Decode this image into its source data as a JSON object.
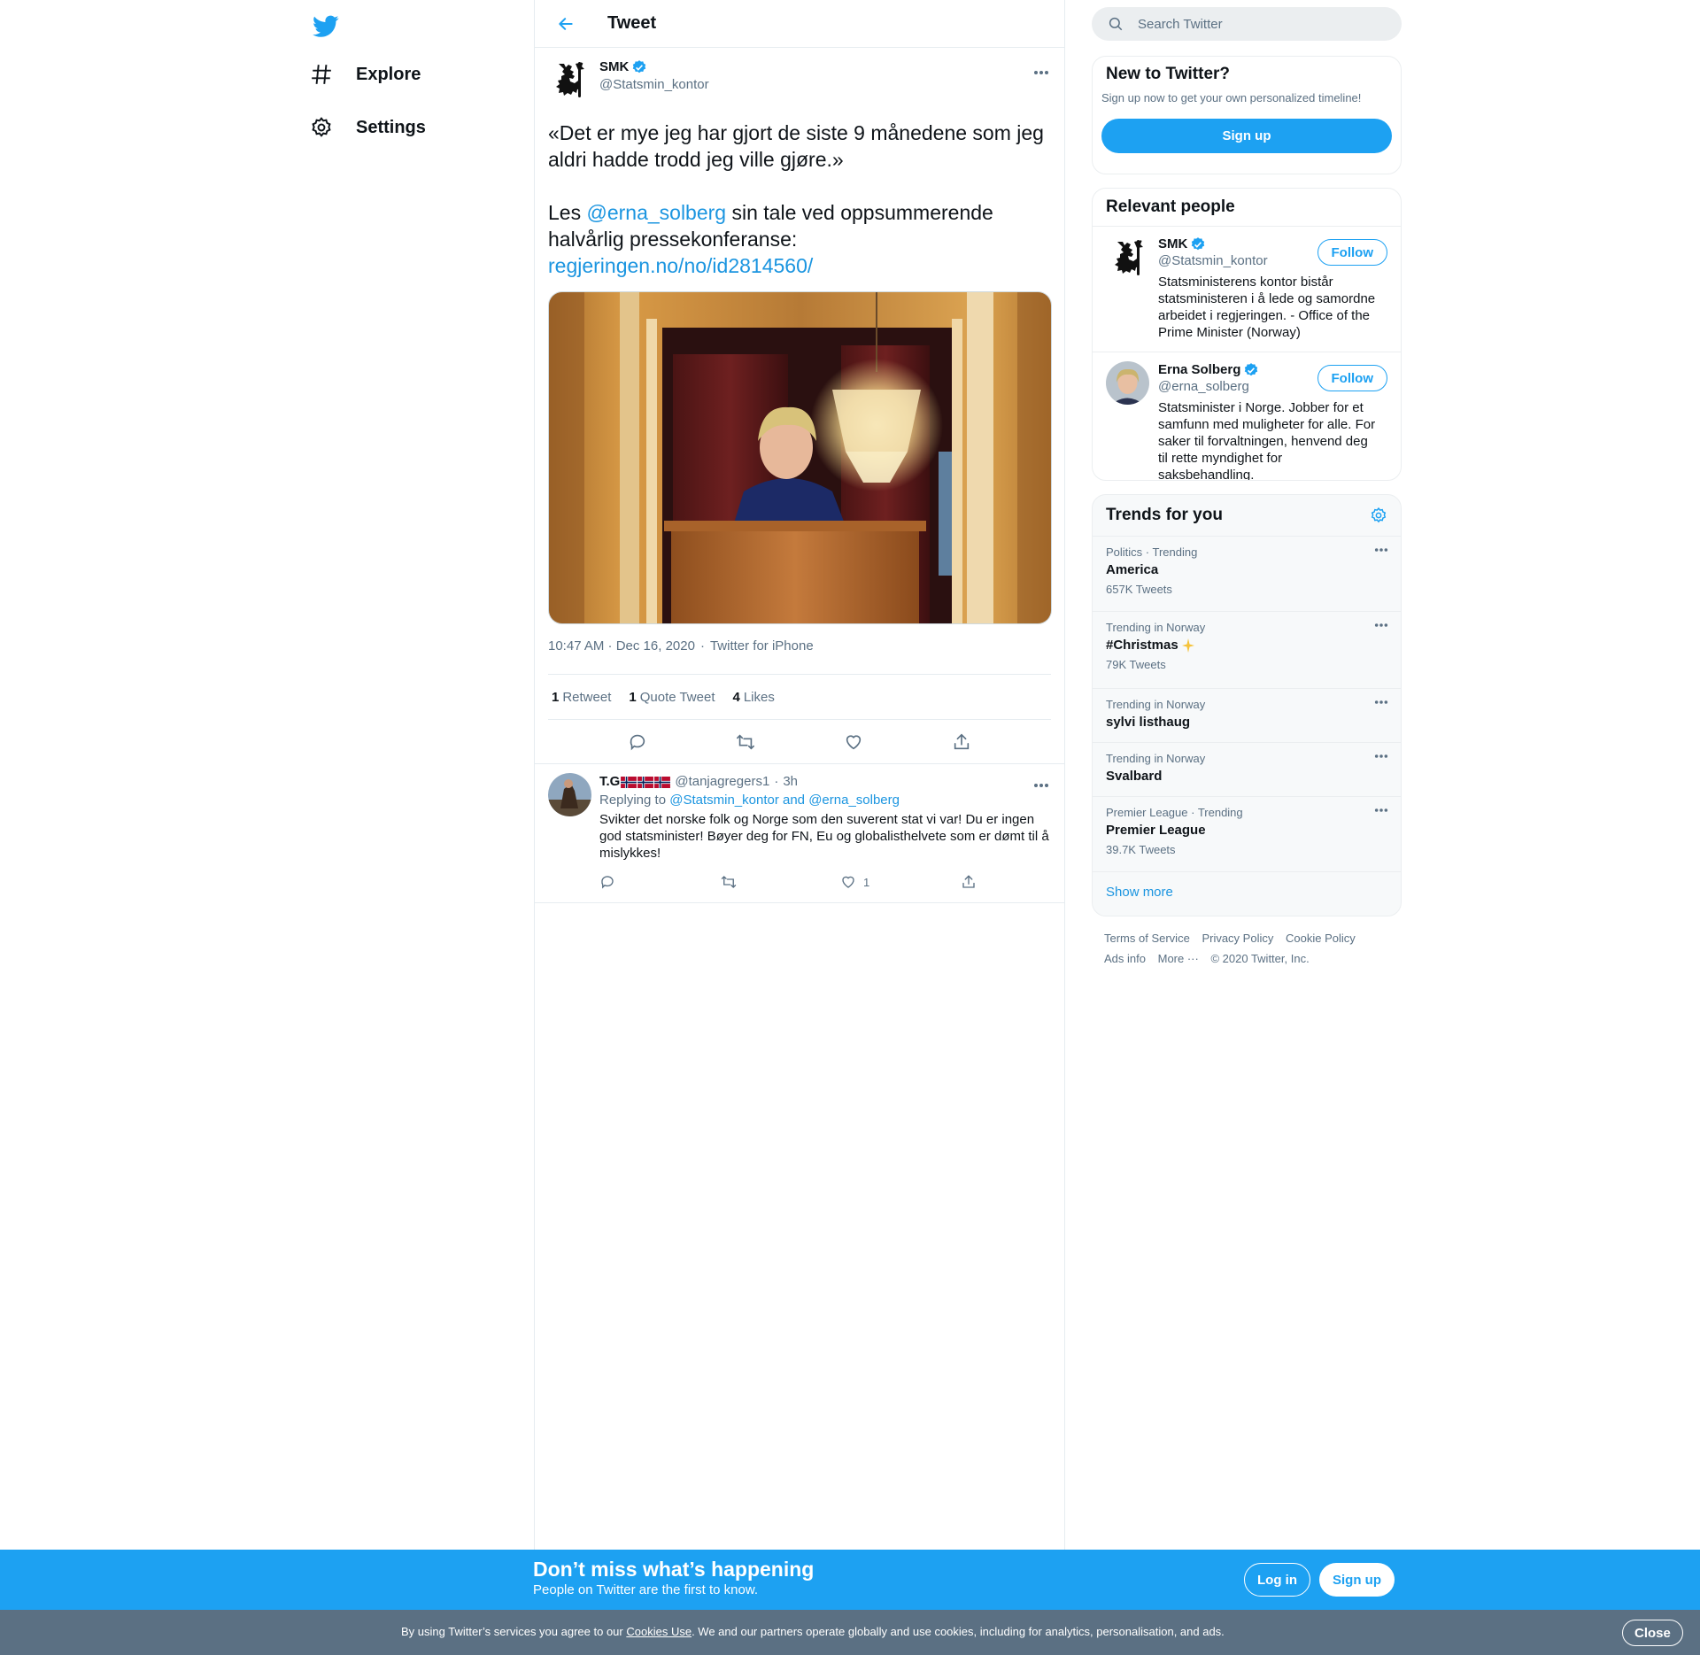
{
  "nav": {
    "items": [
      {
        "label": "Explore",
        "icon": "hashtag-icon"
      },
      {
        "label": "Settings",
        "icon": "gear-icon"
      }
    ]
  },
  "header": {
    "title": "Tweet"
  },
  "tweet": {
    "author_name": "SMK",
    "author_handle": "@Statsmin_kontor",
    "text_line1": "«Det er mye jeg har gjort de siste 9 månedene som jeg aldri hadde trodd jeg ville gjøre.»",
    "text_les": "Les ",
    "mention": "@erna_solberg",
    "text_rest": " sin tale ved oppsummerende halvårlig pressekonferanse:",
    "link": "regjeringen.no/no/id2814560/",
    "time": "10:47 AM · Dec 16, 2020",
    "source": "Twitter for iPhone",
    "retweets": "1",
    "retweets_label": "Retweet",
    "quotes": "1",
    "quotes_label": "Quote Tweet",
    "likes": "4",
    "likes_label": "Likes"
  },
  "reply": {
    "name": "T.G",
    "handle": "@tanjagregers1",
    "age": "3h",
    "replying_prefix": "Replying to ",
    "replying_to": "@Statsmin_kontor and @erna_solberg",
    "text": "Svikter det norske folk og Norge som den suverent stat vi var! Du er ingen god statsminister! Bøyer deg for FN, Eu og globalisthelvete som er dømt til å mislykkes!",
    "likes": "1"
  },
  "search": {
    "placeholder": "Search Twitter"
  },
  "new_to_twitter": {
    "title": "New to Twitter?",
    "subtitle": "Sign up now to get your own personalized timeline!",
    "button": "Sign up"
  },
  "relevant": {
    "title": "Relevant people",
    "follow_label": "Follow",
    "people": [
      {
        "name": "SMK",
        "handle": "@Statsmin_kontor",
        "bio": "Statsministerens kontor bistår statsministeren i å lede og samordne arbeidet i regjeringen. - Office of the Prime Minister (Norway)"
      },
      {
        "name": "Erna Solberg",
        "handle": "@erna_solberg",
        "bio": "Statsminister i Norge. Jobber for et samfunn med muligheter for alle. For saker til forvaltningen, henvend deg til rette myndighet for saksbehandling."
      }
    ]
  },
  "trends": {
    "title": "Trends for you",
    "items": [
      {
        "meta": "Politics · Trending",
        "name": "America",
        "count": "657K Tweets"
      },
      {
        "meta": "Trending in Norway",
        "name": "#Christmas",
        "count": "79K Tweets"
      },
      {
        "meta": "Trending in Norway",
        "name": "sylvi listhaug",
        "count": ""
      },
      {
        "meta": "Trending in Norway",
        "name": "Svalbard",
        "count": ""
      },
      {
        "meta": "Premier League · Trending",
        "name": "Premier League",
        "count": "39.7K Tweets"
      }
    ],
    "show_more": "Show more"
  },
  "footer": {
    "links": [
      "Terms of Service",
      "Privacy Policy",
      "Cookie Policy",
      "Ads info",
      "More ···",
      "© 2020 Twitter, Inc."
    ]
  },
  "bottom_bar": {
    "title": "Don’t miss what’s happening",
    "subtitle": "People on Twitter are the first to know.",
    "login": "Log in",
    "signup": "Sign up"
  },
  "cookie": {
    "prefix": "By using Twitter’s services you agree to our ",
    "link": "Cookies Use",
    "suffix": ". We and our partners operate globally and use cookies, including for analytics, personalisation, and ads.",
    "close": "Close"
  },
  "colors": {
    "accent": "#1da1f2",
    "link": "#1b95e0",
    "secondary_text": "#5b7083",
    "border": "#e6ecf0",
    "cookie_bg": "#5b7083"
  }
}
